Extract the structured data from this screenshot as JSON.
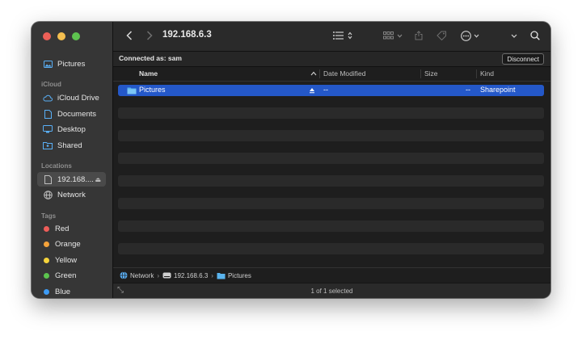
{
  "window": {
    "traffic_lights": {
      "close": "#ec5f57",
      "minimize": "#f4bf4f",
      "zoom": "#5ec34f"
    }
  },
  "sidebar": {
    "favorites": [
      {
        "label": "Pictures",
        "icon": "pictures-folder-icon"
      }
    ],
    "icloud_title": "iCloud",
    "icloud": [
      {
        "label": "iCloud Drive",
        "icon": "cloud-icon"
      },
      {
        "label": "Documents",
        "icon": "document-icon"
      },
      {
        "label": "Desktop",
        "icon": "desktop-icon"
      },
      {
        "label": "Shared",
        "icon": "shared-folder-icon"
      }
    ],
    "locations_title": "Locations",
    "locations": [
      {
        "label": "192.168....",
        "icon": "server-icon",
        "selected": true
      },
      {
        "label": "Network",
        "icon": "globe-icon"
      }
    ],
    "tags_title": "Tags",
    "tags": [
      {
        "label": "Red",
        "color": "#ee5d59"
      },
      {
        "label": "Orange",
        "color": "#f4a23a"
      },
      {
        "label": "Yellow",
        "color": "#f5d33b"
      },
      {
        "label": "Green",
        "color": "#5cc44e"
      },
      {
        "label": "Blue",
        "color": "#3d9bf5"
      }
    ]
  },
  "toolbar": {
    "title": "192.168.6.3"
  },
  "connection": {
    "label": "Connected as: sam",
    "disconnect_label": "Disconnect"
  },
  "columns": {
    "name": "Name",
    "date_modified": "Date Modified",
    "size": "Size",
    "kind": "Kind"
  },
  "rows": [
    {
      "name": "Pictures",
      "date_modified": "--",
      "size": "--",
      "kind": "Sharepoint",
      "selected": true
    }
  ],
  "pathbar": [
    {
      "label": "Network",
      "icon": "globe-icon"
    },
    {
      "label": "192.168.6.3",
      "icon": "server-icon"
    },
    {
      "label": "Pictures",
      "icon": "pictures-folder-icon"
    }
  ],
  "status": {
    "text": "1 of 1 selected"
  }
}
